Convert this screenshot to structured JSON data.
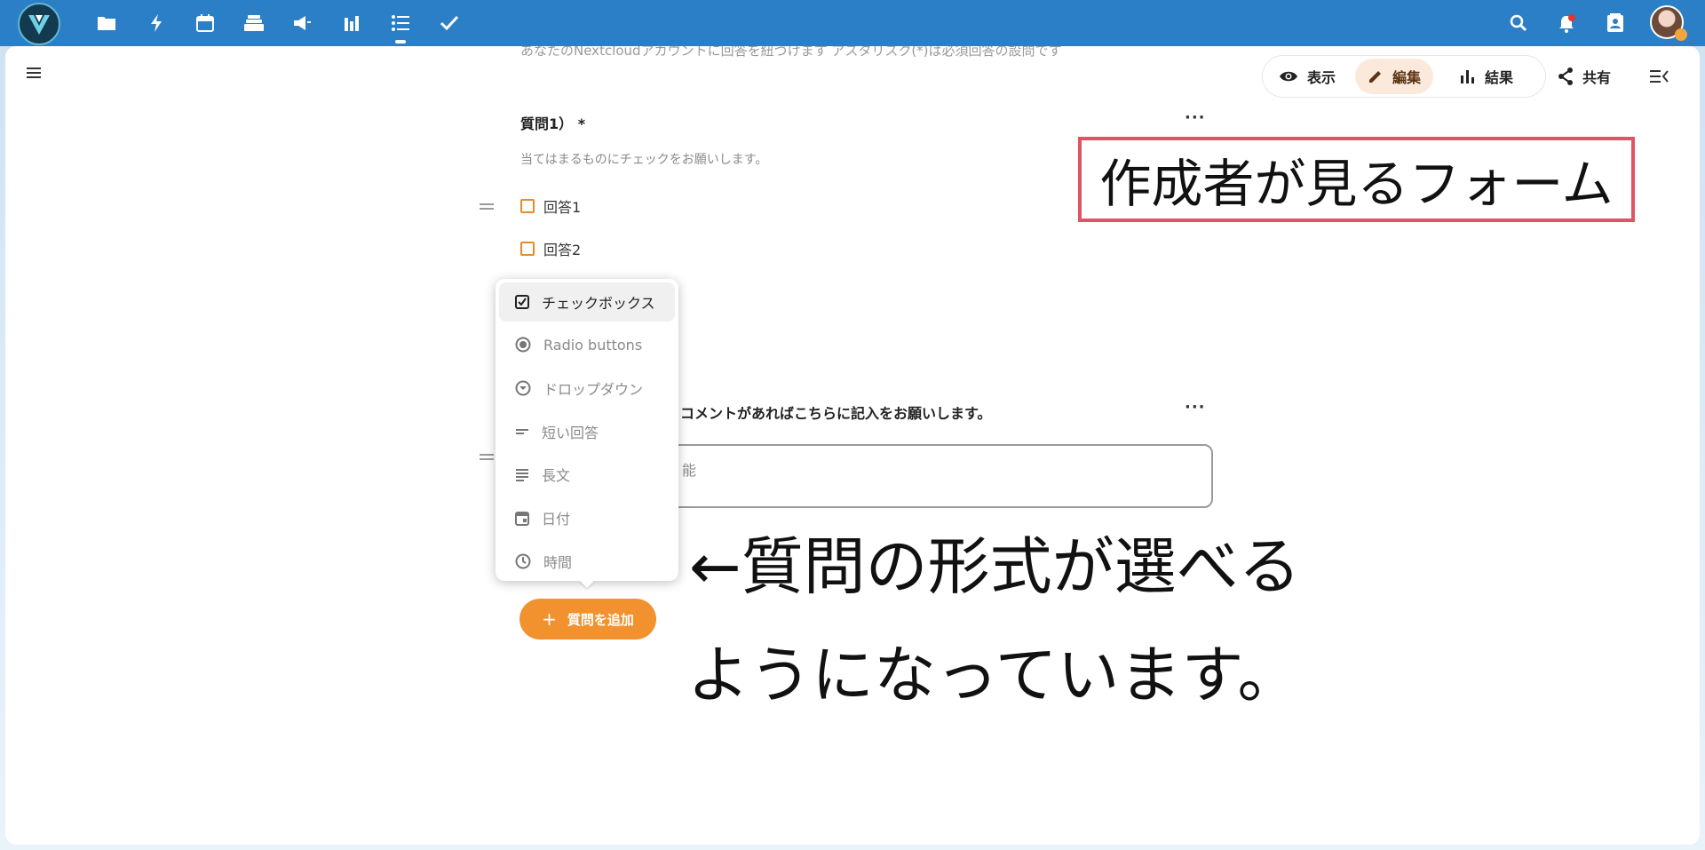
{
  "header": {
    "apps": [
      {
        "name": "folder-icon"
      },
      {
        "name": "activity-icon"
      },
      {
        "name": "calendar-icon"
      },
      {
        "name": "deck-icon"
      },
      {
        "name": "announcements-icon"
      },
      {
        "name": "analytics-icon"
      },
      {
        "name": "forms-icon",
        "active": true
      },
      {
        "name": "tasks-icon"
      }
    ],
    "right_icons": [
      "search-icon",
      "notifications-icon",
      "contacts-icon"
    ]
  },
  "form": {
    "description_top": "あなたのNextcloudアカウントに回答を紐づけます アスタリスク(*)は必須回答の設問です",
    "view_modes": [
      {
        "label": "表示",
        "icon": "eye-icon"
      },
      {
        "label": "編集",
        "icon": "pencil-icon",
        "active": true
      },
      {
        "label": "結果",
        "icon": "bar-chart-icon"
      }
    ],
    "share_label": "共有",
    "question1": {
      "title": "質問1） *",
      "subtitle": "当てはまるものにチェックをお願いします。",
      "options": [
        "回答1",
        "回答2"
      ]
    },
    "question2": {
      "title": "るコメントがあればこちらに記入をお願いします。",
      "placeholder": "能"
    },
    "type_menu": [
      {
        "label": "チェックボックス",
        "icon": "checkbox-icon",
        "active": true
      },
      {
        "label": "Radio buttons",
        "icon": "radio-icon"
      },
      {
        "label": "ドロップダウン",
        "icon": "dropdown-icon"
      },
      {
        "label": "短い回答",
        "icon": "short-answer-icon"
      },
      {
        "label": "長文",
        "icon": "long-text-icon"
      },
      {
        "label": "日付",
        "icon": "date-icon"
      },
      {
        "label": "時間",
        "icon": "clock-icon"
      }
    ],
    "add_question_label": "質問を追加"
  },
  "annotations": {
    "box_text": "作成者が見るフォーム",
    "line1": "←質問の形式が選べる",
    "line2": "ようになっています。"
  },
  "colors": {
    "topbar": "#2a7fc6",
    "accent": "#f1922f",
    "annotation_border": "#e05464"
  }
}
